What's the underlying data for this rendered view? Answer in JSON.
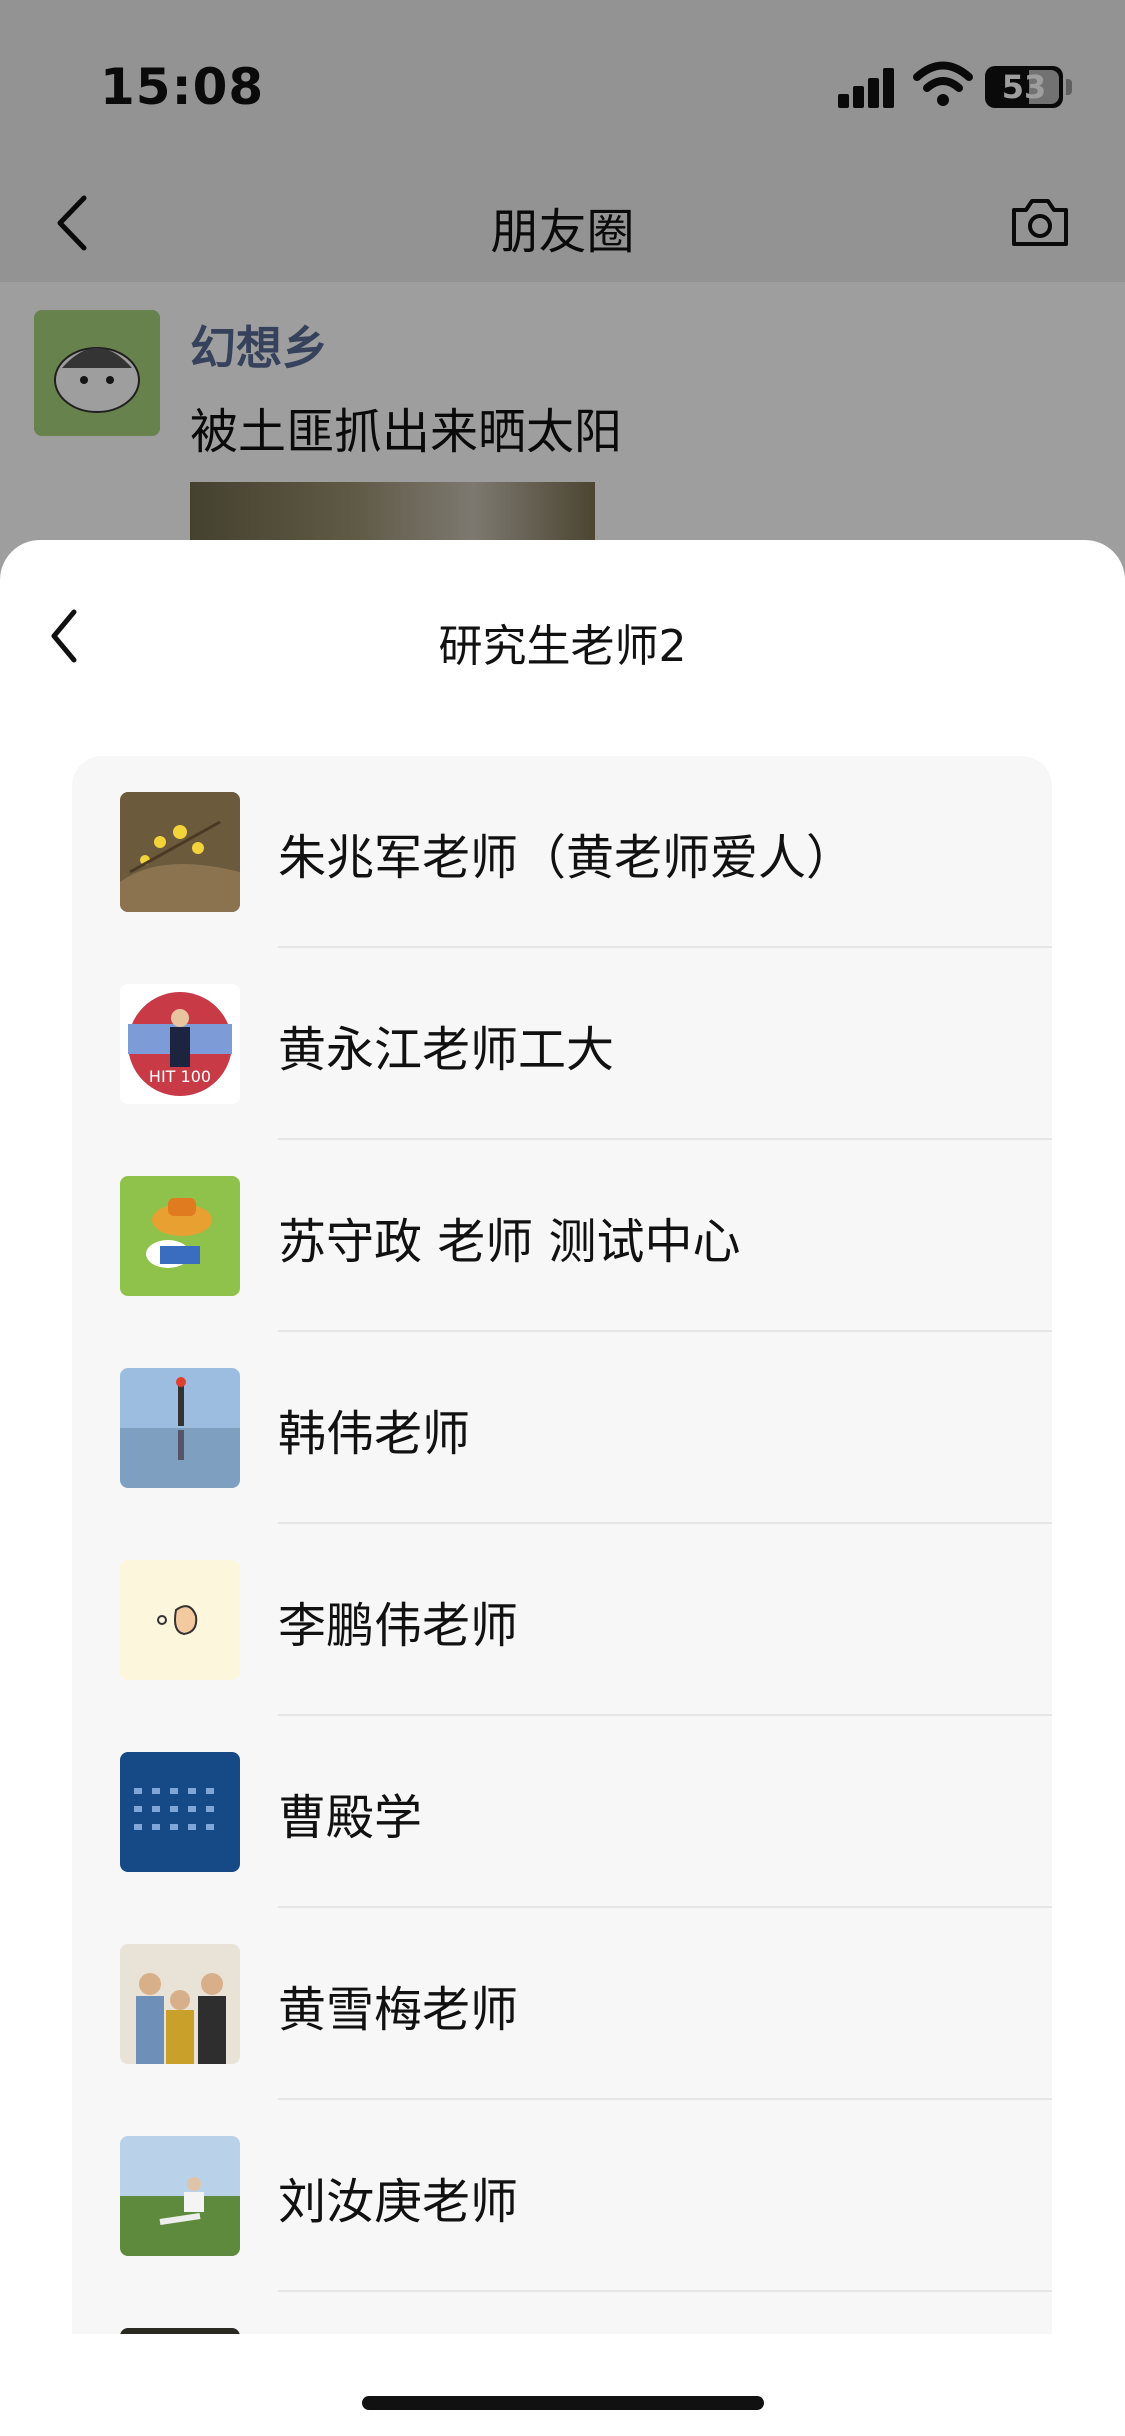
{
  "status_bar": {
    "time": "15:08",
    "battery": "53"
  },
  "nav": {
    "title": "朋友圈"
  },
  "post": {
    "author": "幻想乡",
    "text": "被土匪抓出来晒太阳"
  },
  "sheet": {
    "title": "研究生老师2",
    "contacts": [
      {
        "name": "朱兆军老师（黄老师爱人）",
        "avatar": "forsythia-flower"
      },
      {
        "name": "黄永江老师工大",
        "avatar": "person-hit-100th"
      },
      {
        "name": "苏守政 老师 测试中心",
        "avatar": "cartoon-straw-hat"
      },
      {
        "name": "韩伟老师",
        "avatar": "lake-reflection"
      },
      {
        "name": "李鹏伟老师",
        "avatar": "hand-sticker"
      },
      {
        "name": "曹殿学",
        "avatar": "calendar-blue"
      },
      {
        "name": "黄雪梅老师",
        "avatar": "group-photo"
      },
      {
        "name": "刘汝庚老师",
        "avatar": "grassland-chair"
      }
    ]
  },
  "colors": {
    "link_blue": "#576b95",
    "sheet_bg": "#ffffff",
    "list_bg": "#f7f7f7"
  }
}
